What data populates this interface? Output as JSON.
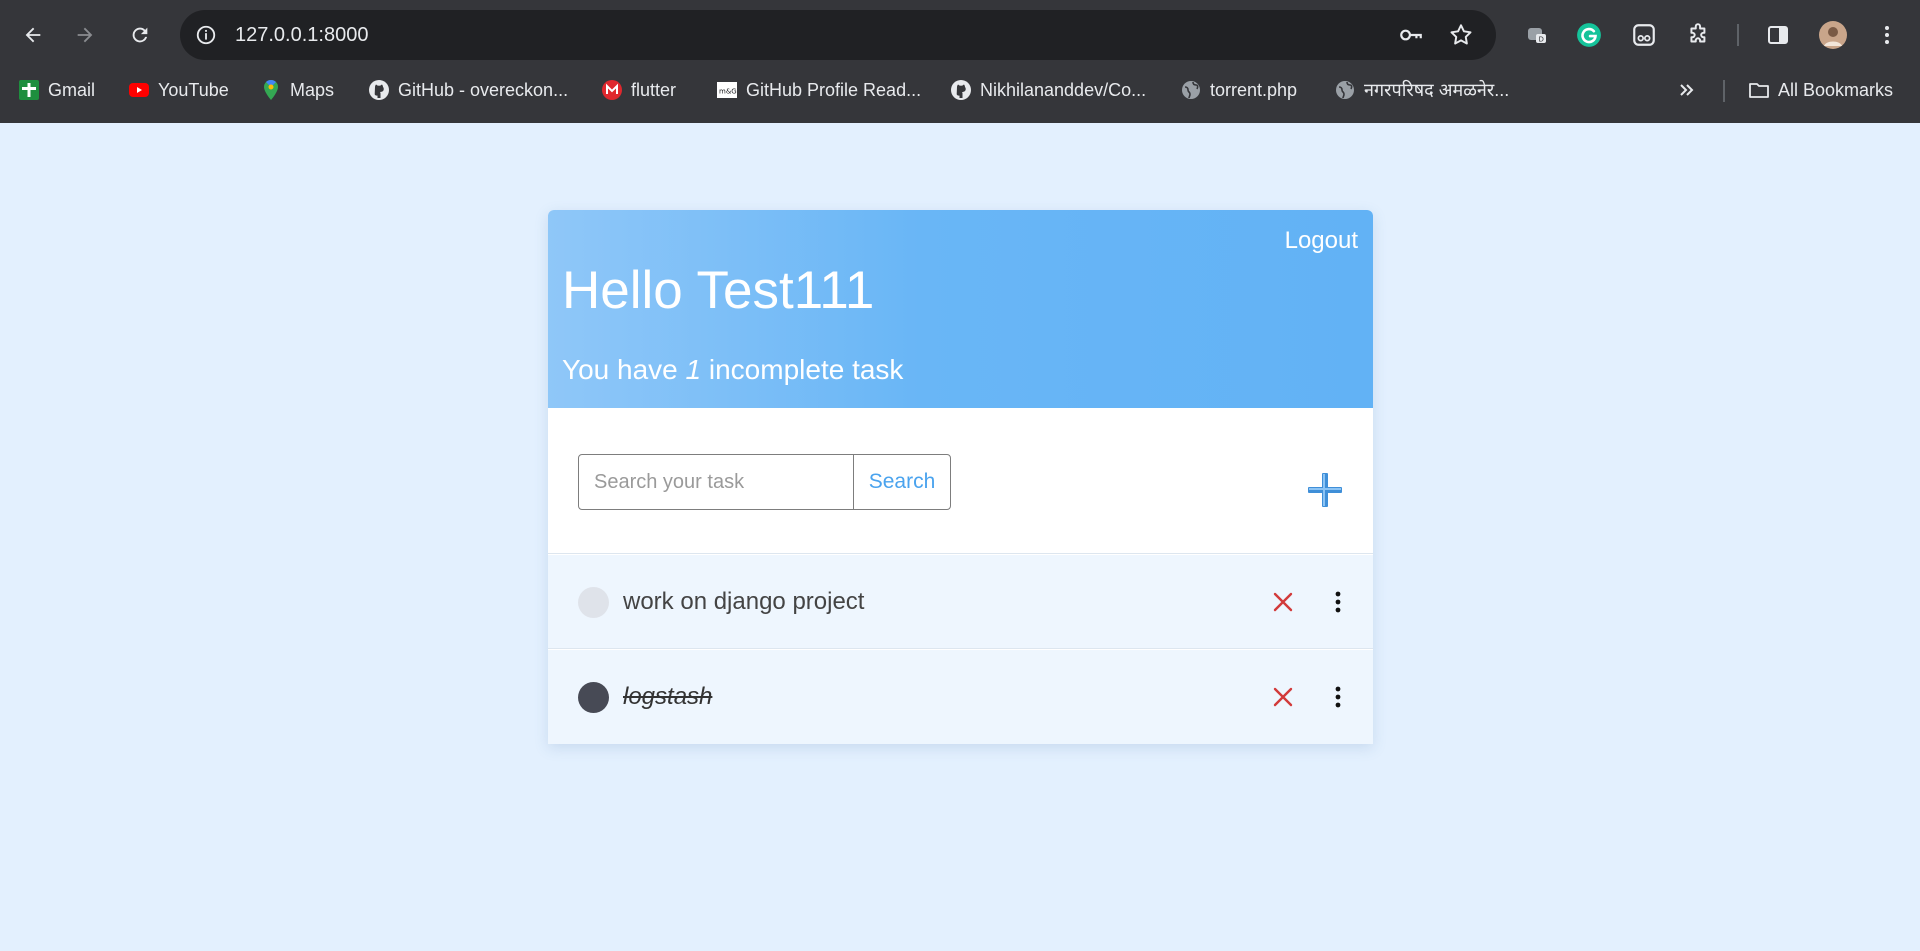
{
  "browser": {
    "url": "127.0.0.1:8000",
    "bookmarks": [
      {
        "label": "Gmail",
        "icon": "gmail-icon"
      },
      {
        "label": "YouTube",
        "icon": "youtube-icon"
      },
      {
        "label": "Maps",
        "icon": "maps-icon"
      },
      {
        "label": "GitHub - overeckon...",
        "icon": "github-icon"
      },
      {
        "label": "flutter",
        "icon": "flutter-bookmark-icon"
      },
      {
        "label": "GitHub Profile Read...",
        "icon": "profile-readme-icon"
      },
      {
        "label": "Nikhilananddev/Co...",
        "icon": "github-icon"
      },
      {
        "label": "torrent.php",
        "icon": "globe-icon"
      },
      {
        "label": "नगरपरिषद अमळनेर...",
        "icon": "globe-icon"
      }
    ],
    "all_bookmarks_label": "All Bookmarks"
  },
  "app": {
    "logout_label": "Logout",
    "greeting": "Hello Test111",
    "summary_prefix": "You have ",
    "incomplete_count": "1",
    "summary_suffix": " incomplete task",
    "search": {
      "placeholder": "Search your task",
      "button_label": "Search"
    },
    "tasks": [
      {
        "title": "work on django project",
        "completed": false
      },
      {
        "title": "logstash",
        "completed": true
      }
    ]
  },
  "colors": {
    "page_background": "#e3f0fe",
    "header_gradient_start": "#8fc7f8",
    "header_gradient_end": "#62b2f5",
    "accent_blue": "#4aa3ee",
    "delete_red": "#d23a3a"
  }
}
